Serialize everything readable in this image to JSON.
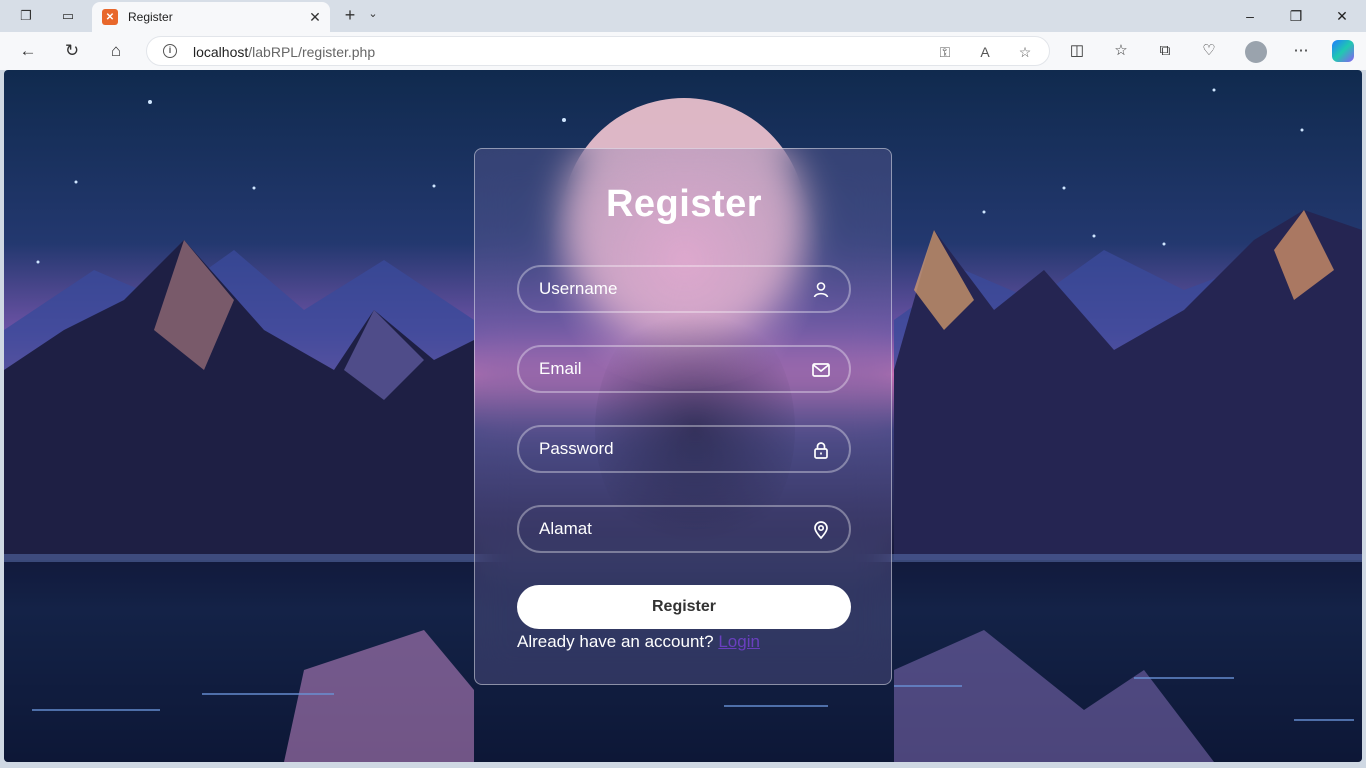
{
  "browser": {
    "tab_title": "Register",
    "favicon_text": "✕",
    "url_host": "localhost",
    "url_path": "/labRPL/register.php"
  },
  "form": {
    "title": "Register",
    "fields": [
      {
        "label": "Username",
        "icon": "user-icon"
      },
      {
        "label": "Email",
        "icon": "mail-icon"
      },
      {
        "label": "Password",
        "icon": "lock-icon"
      },
      {
        "label": "Alamat",
        "icon": "location-pin-icon"
      }
    ],
    "submit_label": "Register",
    "login_prompt": "Already have an account?",
    "login_link": "Login"
  },
  "colors": {
    "accent_link": "#6a3fbf",
    "button_bg": "#ffffff"
  }
}
